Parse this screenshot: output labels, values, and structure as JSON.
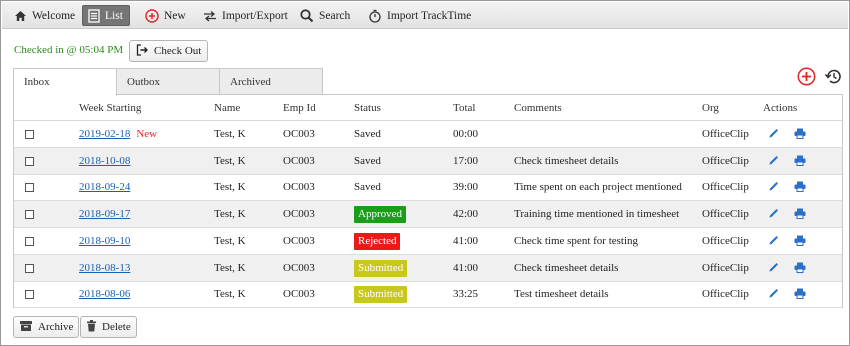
{
  "toolbar": {
    "welcome": "Welcome",
    "list": "List",
    "new": "New",
    "import_export": "Import/Export",
    "search": "Search",
    "import_tracktime": "Import TrackTime"
  },
  "checkin": {
    "status_text": "Checked in @ 05:04 PM",
    "checkout_label": "Check Out"
  },
  "tabs": [
    {
      "label": "Inbox",
      "active": true
    },
    {
      "label": "Outbox",
      "active": false
    },
    {
      "label": "Archived",
      "active": false
    }
  ],
  "table": {
    "headers": {
      "week": "Week Starting",
      "name": "Name",
      "emp": "Emp Id",
      "status": "Status",
      "total": "Total",
      "comments": "Comments",
      "org": "Org",
      "actions": "Actions"
    },
    "rows": [
      {
        "week": "2019-02-18",
        "new": "New",
        "name": "Test, K",
        "emp": "OC003",
        "status": "Saved",
        "total": "00:00",
        "comments": "",
        "org": "OfficeClip"
      },
      {
        "week": "2018-10-08",
        "new": "",
        "name": "Test, K",
        "emp": "OC003",
        "status": "Saved",
        "total": "17:00",
        "comments": "Check timesheet details",
        "org": "OfficeClip"
      },
      {
        "week": "2018-09-24",
        "new": "",
        "name": "Test, K",
        "emp": "OC003",
        "status": "Saved",
        "total": "39:00",
        "comments": "Time spent on each project mentioned",
        "org": "OfficeClip"
      },
      {
        "week": "2018-09-17",
        "new": "",
        "name": "Test, K",
        "emp": "OC003",
        "status": "Approved",
        "total": "42:00",
        "comments": "Training time mentioned in timesheet",
        "org": "OfficeClip"
      },
      {
        "week": "2018-09-10",
        "new": "",
        "name": "Test, K",
        "emp": "OC003",
        "status": "Rejected",
        "total": "41:00",
        "comments": "Check time spent for testing",
        "org": "OfficeClip"
      },
      {
        "week": "2018-08-13",
        "new": "",
        "name": "Test, K",
        "emp": "OC003",
        "status": "Submitted",
        "total": "41:00",
        "comments": "Check timesheet details",
        "org": "OfficeClip"
      },
      {
        "week": "2018-08-06",
        "new": "",
        "name": "Test, K",
        "emp": "OC003",
        "status": "Submitted",
        "total": "33:25",
        "comments": "Test timesheet details",
        "org": "OfficeClip"
      }
    ]
  },
  "status_colors": {
    "Approved": "#1a9e1a",
    "Rejected": "#e81b1b",
    "Submitted": "#c8c81a"
  },
  "colors": {
    "checked_in_text": "#2b8a1e",
    "link": "#1a5fb4",
    "new_badge": "#e0262b",
    "action_icon": "#2a6fc9",
    "add_icon": "#e0262b"
  },
  "icons": {
    "welcome": "home-icon",
    "list": "list-icon",
    "new": "plus-circle-icon",
    "import_export": "swap-arrows-icon",
    "search": "search-icon",
    "import_tracktime": "stopwatch-icon",
    "checkout": "sign-out-icon",
    "edit": "pencil-icon",
    "print": "printer-icon",
    "archive": "archive-box-icon",
    "delete": "trash-icon",
    "add": "add-circle-icon",
    "history": "history-icon"
  },
  "footer": {
    "archive_label": "Archive",
    "delete_label": "Delete"
  }
}
